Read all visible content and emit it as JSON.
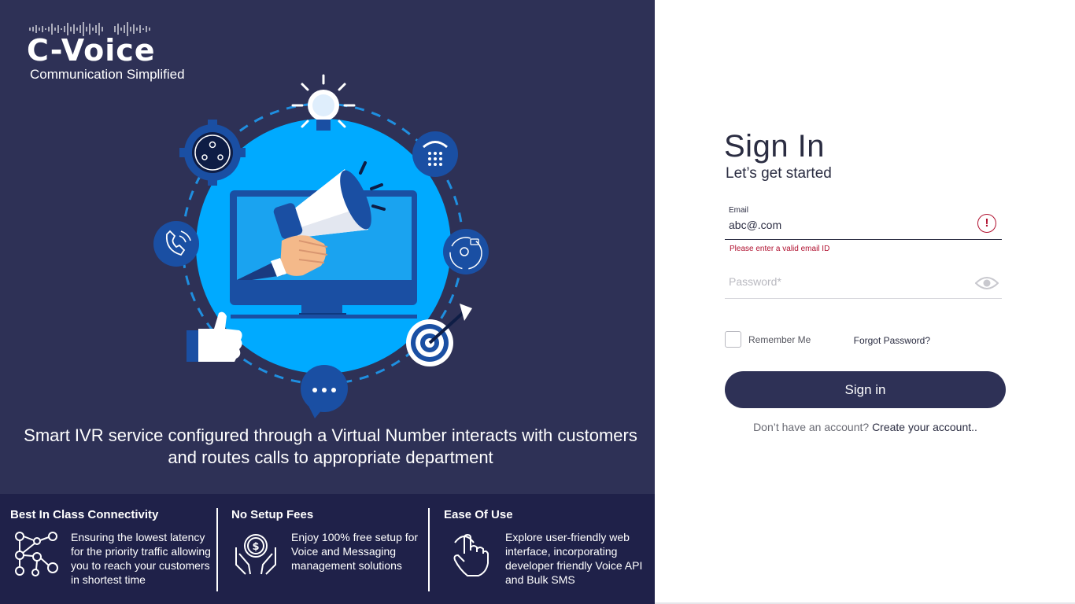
{
  "brand": {
    "logo_text": "C-Voice",
    "tagline": "Communication Simplified"
  },
  "hero": {
    "caption": "Smart IVR service configured through a Virtual Number interacts with customers and routes calls to appropriate department"
  },
  "features": [
    {
      "title": "Best In Class Connectivity",
      "text": "Ensuring the lowest latency for the priority traffic allowing you to reach your customers in shortest time",
      "icon": "network-nodes-icon"
    },
    {
      "title": "No Setup Fees",
      "text": "Enjoy 100% free setup for Voice and Messaging management solutions",
      "icon": "hands-coin-icon"
    },
    {
      "title": "Ease Of Use",
      "text": "Explore user-friendly web interface, incorporating developer friendly Voice API and Bulk SMS",
      "icon": "touch-hand-icon"
    }
  ],
  "signin": {
    "title": "Sign In",
    "subtitle": "Let’s get started",
    "email": {
      "label": "Email",
      "value": "abc@.com",
      "error": "Please enter a valid email ID"
    },
    "password": {
      "placeholder": "Password*"
    },
    "remember_label": "Remember Me",
    "forgot_label": "Forgot Password?",
    "button_label": "Sign in",
    "signup_prompt": "Don’t have an account?",
    "signup_link": "Create your account.."
  },
  "colors": {
    "panel": "#2e3156",
    "panel_dark": "#1f2149",
    "accent_blue": "#00aaff",
    "error": "#b0102f"
  }
}
